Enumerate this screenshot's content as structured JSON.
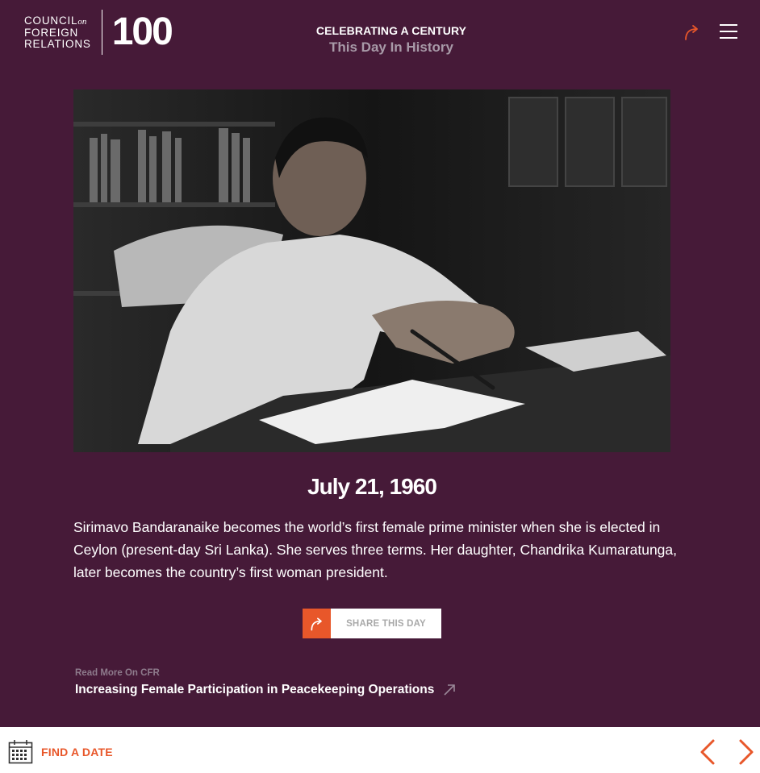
{
  "brand": {
    "logo_line1": "COUNCIL",
    "logo_on": "on",
    "logo_line2": "FOREIGN",
    "logo_line3": "RELATIONS",
    "logo_number": "100"
  },
  "header": {
    "kicker": "CELEBRATING A CENTURY",
    "subtitle": "This Day In History"
  },
  "entry": {
    "date": "July 21, 1960",
    "description": "Sirimavo Bandaranaike becomes the world’s first female prime minister when she is elected in Ceylon (present-day Sri Lanka). She serves three terms. Her daughter, Chandrika Kumaratunga, later becomes the country’s first woman president."
  },
  "share": {
    "label": "SHARE THIS DAY"
  },
  "read_more": {
    "kicker": "Read More On CFR",
    "link": "Increasing Female Participation in Peacekeeping Operations"
  },
  "footer": {
    "find_date": "FIND A DATE"
  },
  "colors": {
    "background": "#461a38",
    "accent": "#e8572a"
  },
  "icons": [
    "share-arrow-icon",
    "menu-icon",
    "external-link-icon",
    "calendar-icon",
    "chevron-left-icon",
    "chevron-right-icon"
  ]
}
